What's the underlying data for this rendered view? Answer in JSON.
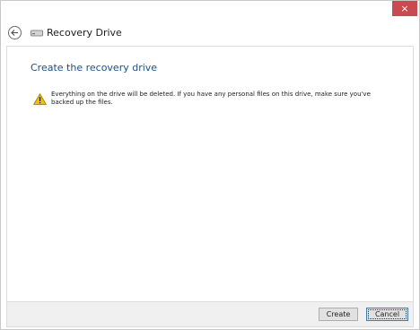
{
  "window": {
    "close_glyph": "×"
  },
  "header": {
    "title": "Recovery Drive",
    "back_icon": "back-arrow-icon",
    "drive_icon": "drive-icon"
  },
  "content": {
    "title": "Create the recovery drive",
    "warning_text": "Everything on the drive will be deleted. If you have any personal files on this drive, make sure you've backed up the files.",
    "warning_icon": "warning-icon"
  },
  "footer": {
    "create_label": "Create",
    "cancel_label": "Cancel"
  },
  "colors": {
    "close_button": "#c74b50",
    "content_title": "#1b4f8c",
    "footer_bg": "#f0f0f0",
    "warning_yellow": "#f2c200"
  }
}
